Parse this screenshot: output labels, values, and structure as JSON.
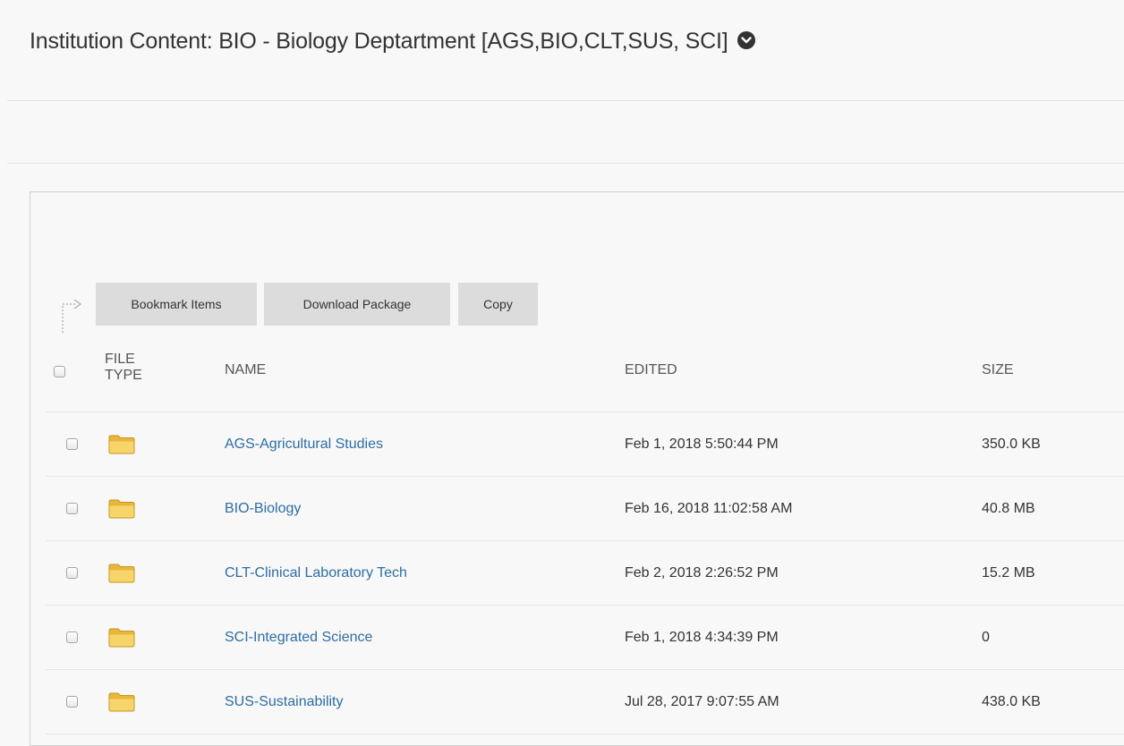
{
  "header": {
    "title": "Institution Content: BIO - Biology Deptartment [AGS,BIO,CLT,SUS, SCI]"
  },
  "toolbar": {
    "bookmark_label": "Bookmark Items",
    "download_label": "Download Package",
    "copy_label": "Copy"
  },
  "table": {
    "columns": {
      "file_type": "FILE TYPE",
      "name": "NAME",
      "edited": "EDITED",
      "size": "SIZE"
    },
    "rows": [
      {
        "name": "AGS-Agricultural Studies",
        "edited": "Feb 1, 2018 5:50:44 PM",
        "size": "350.0 KB",
        "icon": "folder-icon"
      },
      {
        "name": "BIO-Biology",
        "edited": "Feb 16, 2018 11:02:58 AM",
        "size": "40.8 MB",
        "icon": "folder-icon"
      },
      {
        "name": "CLT-Clinical Laboratory Tech",
        "edited": "Feb 2, 2018 2:26:52 PM",
        "size": "15.2 MB",
        "icon": "folder-icon"
      },
      {
        "name": "SCI-Integrated Science",
        "edited": "Feb 1, 2018 4:34:39 PM",
        "size": "0",
        "icon": "folder-icon"
      },
      {
        "name": "SUS-Sustainability",
        "edited": "Jul 28, 2017 9:07:55 AM",
        "size": "438.0 KB",
        "icon": "folder-icon"
      }
    ]
  },
  "colors": {
    "link": "#2e6da4",
    "button_bg": "#dcdcdc",
    "folder": "#f0c040",
    "page_bg": "#f8f8f8"
  }
}
